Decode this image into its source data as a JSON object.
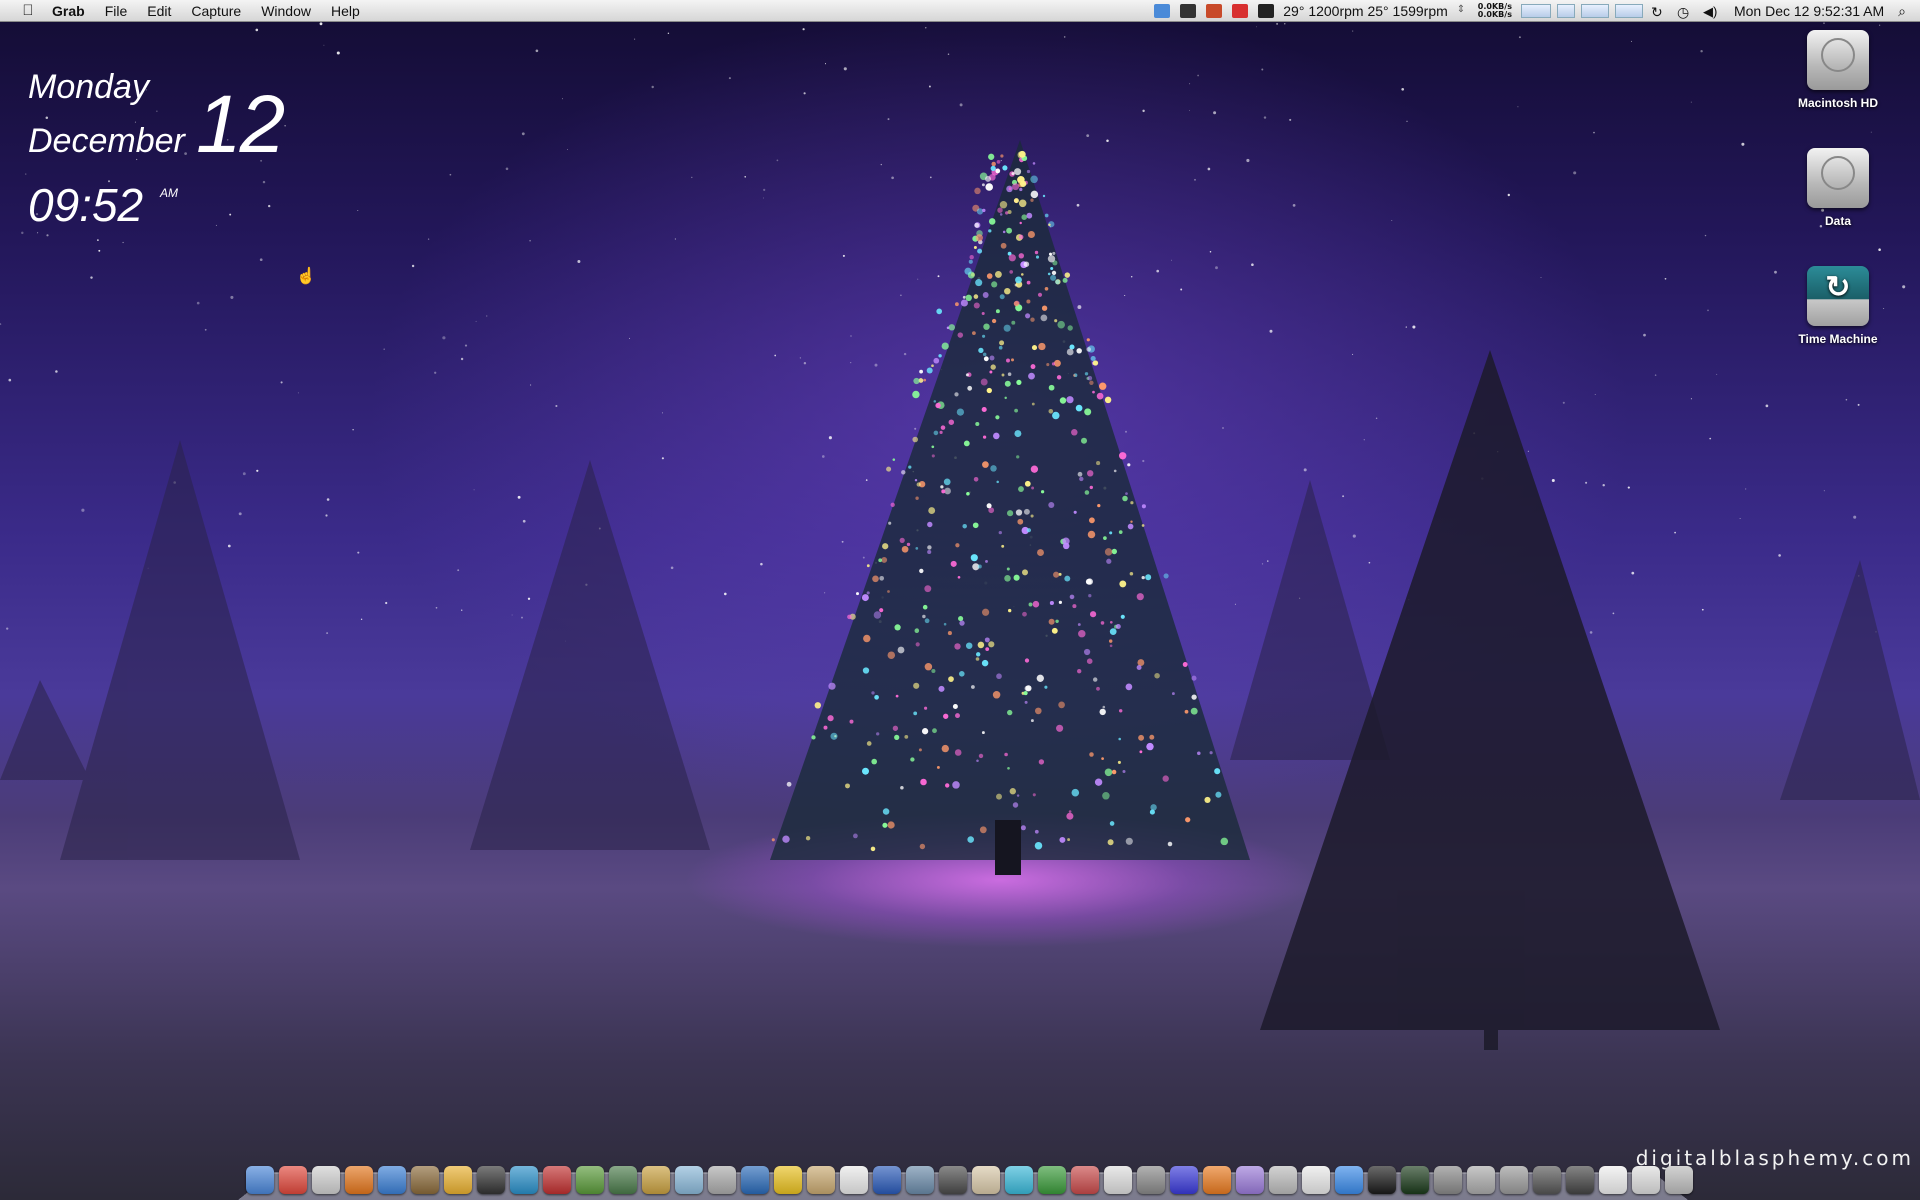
{
  "menubar": {
    "apple": "",
    "app_name": "Grab",
    "menus": [
      "File",
      "Edit",
      "Capture",
      "Window",
      "Help"
    ],
    "status": {
      "fan_text": "29° 1200rpm 25° 1599rpm",
      "net_up": "0.0KB/s",
      "net_down": "0.0KB/s",
      "clock": "Mon Dec 12  9:52:31 AM",
      "spotlight": "⌕"
    }
  },
  "widget": {
    "day": "Monday",
    "month": "December",
    "date": "12",
    "time": "09:52",
    "ampm": "AM"
  },
  "desktop": {
    "icons": [
      {
        "label": "Macintosh HD",
        "icon": "hard-drive-icon"
      },
      {
        "label": "Data",
        "icon": "hard-drive-icon"
      },
      {
        "label": "Time Machine",
        "icon": "time-machine-icon"
      }
    ]
  },
  "watermark": "digitalblasphemy.com",
  "dock": {
    "items": [
      {
        "name": "finder",
        "color": "#4a86d8"
      },
      {
        "name": "chrome",
        "color": "#e0483c"
      },
      {
        "name": "calendar-app",
        "color": "#cfcfcf"
      },
      {
        "name": "firefox",
        "color": "#e3761d"
      },
      {
        "name": "itunes",
        "color": "#3b7fd4"
      },
      {
        "name": "iphoto",
        "color": "#8a6a3a"
      },
      {
        "name": "picasa",
        "color": "#e8b030"
      },
      {
        "name": "camera",
        "color": "#333333"
      },
      {
        "name": "photoshop-elements",
        "color": "#2a8fc8"
      },
      {
        "name": "photo-booth",
        "color": "#c03030"
      },
      {
        "name": "garden",
        "color": "#5a9a3a"
      },
      {
        "name": "finance",
        "color": "#4a7a4a"
      },
      {
        "name": "scripts",
        "color": "#c8a040"
      },
      {
        "name": "fish",
        "color": "#8ab8d8"
      },
      {
        "name": "preview",
        "color": "#aaaaaa"
      },
      {
        "name": "word",
        "color": "#2a6ab8"
      },
      {
        "name": "outlook",
        "color": "#e8c020"
      },
      {
        "name": "contacts",
        "color": "#c8a870"
      },
      {
        "name": "ical",
        "color": "#e8e8e8"
      },
      {
        "name": "adium",
        "color": "#2a5ab8"
      },
      {
        "name": "mail",
        "color": "#6a8aa8"
      },
      {
        "name": "facetime",
        "color": "#4a4a4a"
      },
      {
        "name": "textedit",
        "color": "#d8c8a8"
      },
      {
        "name": "cyberduck",
        "color": "#3ab8d8"
      },
      {
        "name": "utorrent",
        "color": "#3a9a3a"
      },
      {
        "name": "transmit",
        "color": "#c84a4a"
      },
      {
        "name": "dvd-player",
        "color": "#dddddd"
      },
      {
        "name": "disk-utility",
        "color": "#888888"
      },
      {
        "name": "headphones",
        "color": "#3a3ad8"
      },
      {
        "name": "vlc",
        "color": "#e87a20"
      },
      {
        "name": "stickies",
        "color": "#9a7ad8"
      },
      {
        "name": "script-editor",
        "color": "#bbbbbb"
      },
      {
        "name": "printer",
        "color": "#e8e8e8"
      },
      {
        "name": "app-store",
        "color": "#3a8ae8"
      },
      {
        "name": "terminal",
        "color": "#1a1a1a"
      },
      {
        "name": "activity-monitor",
        "color": "#1a3a1a"
      },
      {
        "name": "automator",
        "color": "#888888"
      },
      {
        "name": "screenshot",
        "color": "#aaaaaa"
      },
      {
        "name": "system-preferences",
        "color": "#999999"
      },
      {
        "name": "photo-viewer",
        "color": "#555555"
      },
      {
        "name": "music",
        "color": "#444444"
      },
      {
        "name": "documents",
        "color": "#eeeeee"
      },
      {
        "name": "downloads",
        "color": "#dddddd"
      },
      {
        "name": "trash",
        "color": "#bbbbbb"
      }
    ]
  }
}
